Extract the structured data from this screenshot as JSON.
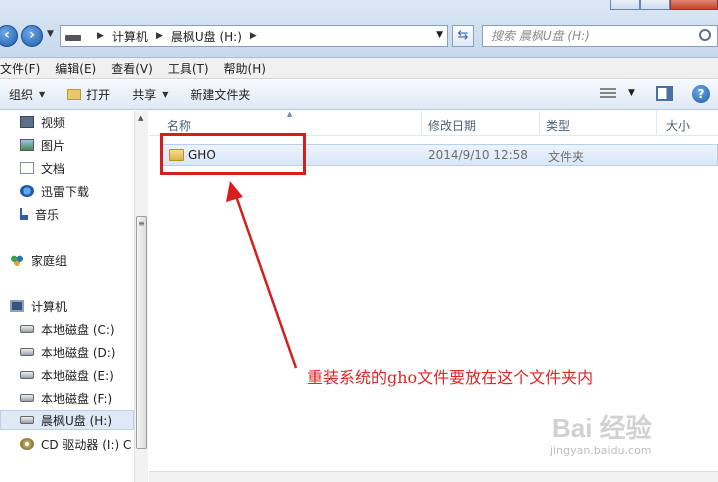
{
  "address": {
    "crumbs": [
      "计算机",
      "晨枫U盘 (H:)"
    ],
    "search_placeholder": "搜索 晨枫U盘 (H:)"
  },
  "menu": [
    "文件(F)",
    "编辑(E)",
    "查看(V)",
    "工具(T)",
    "帮助(H)"
  ],
  "toolbar": {
    "organize": "组织",
    "open": "打开",
    "share": "共享",
    "new_folder": "新建文件夹"
  },
  "nav": {
    "libraries": [
      "视频",
      "图片",
      "文档",
      "迅雷下载",
      "音乐"
    ],
    "homegroup": "家庭组",
    "computer": "计算机",
    "drives": [
      "本地磁盘 (C:)",
      "本地磁盘 (D:)",
      "本地磁盘 (E:)",
      "本地磁盘 (F:)",
      "晨枫U盘 (H:)",
      "CD 驱动器 (I:) C"
    ]
  },
  "columns": [
    "名称",
    "修改日期",
    "类型",
    "大小"
  ],
  "files": [
    {
      "name": "GHO",
      "modified": "2014/9/10 12:58",
      "type": "文件夹",
      "size": ""
    }
  ],
  "annotation": {
    "text": "重装系统的gho文件要放在这个文件夹内",
    "color": "#e12424"
  },
  "watermark": {
    "main": "Bai  经验",
    "sub": "jingyan.baidu.com"
  }
}
